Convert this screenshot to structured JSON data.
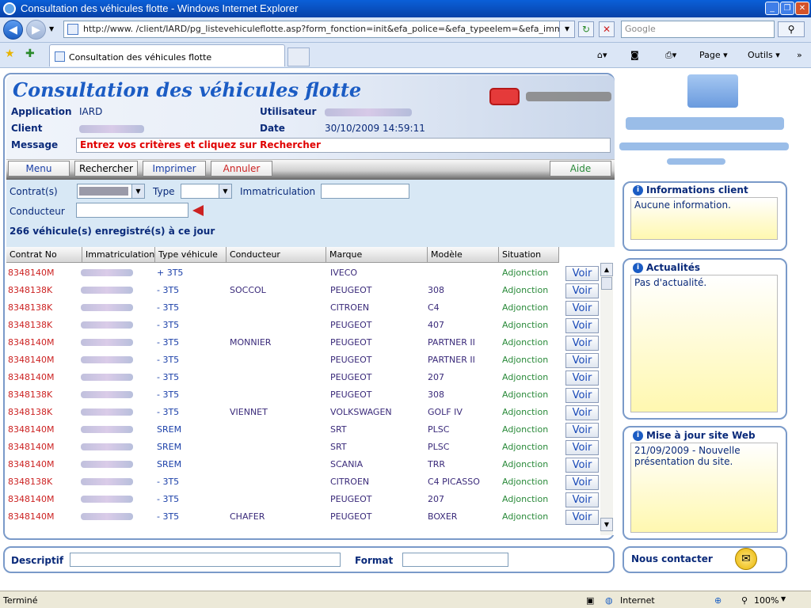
{
  "window": {
    "title": "Consultation des véhicules flotte - Windows Internet Explorer"
  },
  "browser": {
    "url": "http://www.                   /client/IARD/pg_listevehiculeflotte.asp?form_fonction=init&efa_police=&efa_typeelem=&efa_imma",
    "search_placeholder": "Google",
    "tab_label": "Consultation des véhicules flotte",
    "cmd_page": "Page",
    "cmd_outils": "Outils"
  },
  "header": {
    "title": "Consultation des véhicules flotte",
    "application_label": "Application",
    "application_value": "IARD",
    "utilisateur_label": "Utilisateur",
    "client_label": "Client",
    "date_label": "Date",
    "date_value": "30/10/2009 14:59:11",
    "message_label": "Message",
    "message_value": "Entrez vos critères et cliquez sur Rechercher"
  },
  "toolbar": {
    "menu": "Menu",
    "rechercher": "Rechercher",
    "imprimer": "Imprimer",
    "annuler": "Annuler",
    "aide": "Aide"
  },
  "filters": {
    "contrat_label": "Contrat(s)",
    "type_label": "Type",
    "immat_label": "Immatriculation",
    "conducteur_label": "Conducteur",
    "count_text": "266 véhicule(s) enregistré(s) à ce jour"
  },
  "grid": {
    "headers": [
      "Contrat No",
      "Immatriculation",
      "Type véhicule",
      "Conducteur",
      "Marque",
      "Modèle",
      "Situation"
    ],
    "voir_label": "Voir",
    "rows": [
      {
        "contrat": "8348140M",
        "type": "+ 3T5",
        "conducteur": "",
        "marque": "IVECO",
        "modele": "",
        "situation": "Adjonction"
      },
      {
        "contrat": "8348138K",
        "type": "- 3T5",
        "conducteur": "SOCCOL",
        "marque": "PEUGEOT",
        "modele": "308",
        "situation": "Adjonction"
      },
      {
        "contrat": "8348138K",
        "type": "- 3T5",
        "conducteur": "",
        "marque": "CITROEN",
        "modele": "C4",
        "situation": "Adjonction"
      },
      {
        "contrat": "8348138K",
        "type": "- 3T5",
        "conducteur": "",
        "marque": "PEUGEOT",
        "modele": "407",
        "situation": "Adjonction"
      },
      {
        "contrat": "8348140M",
        "type": "- 3T5",
        "conducteur": "MONNIER",
        "marque": "PEUGEOT",
        "modele": "PARTNER II",
        "situation": "Adjonction"
      },
      {
        "contrat": "8348140M",
        "type": "- 3T5",
        "conducteur": "",
        "marque": "PEUGEOT",
        "modele": "PARTNER II",
        "situation": "Adjonction"
      },
      {
        "contrat": "8348140M",
        "type": "- 3T5",
        "conducteur": "",
        "marque": "PEUGEOT",
        "modele": "207",
        "situation": "Adjonction"
      },
      {
        "contrat": "8348138K",
        "type": "- 3T5",
        "conducteur": "",
        "marque": "PEUGEOT",
        "modele": "308",
        "situation": "Adjonction"
      },
      {
        "contrat": "8348138K",
        "type": "- 3T5",
        "conducteur": "VIENNET",
        "marque": "VOLKSWAGEN",
        "modele": "GOLF IV",
        "situation": "Adjonction"
      },
      {
        "contrat": "8348140M",
        "type": "SREM",
        "conducteur": "",
        "marque": "SRT",
        "modele": "PLSC",
        "situation": "Adjonction"
      },
      {
        "contrat": "8348140M",
        "type": "SREM",
        "conducteur": "",
        "marque": "SRT",
        "modele": "PLSC",
        "situation": "Adjonction"
      },
      {
        "contrat": "8348140M",
        "type": "SREM",
        "conducteur": "",
        "marque": "SCANIA",
        "modele": "TRR",
        "situation": "Adjonction"
      },
      {
        "contrat": "8348138K",
        "type": "- 3T5",
        "conducteur": "",
        "marque": "CITROEN",
        "modele": "C4 PICASSO",
        "situation": "Adjonction"
      },
      {
        "contrat": "8348140M",
        "type": "- 3T5",
        "conducteur": "",
        "marque": "PEUGEOT",
        "modele": "207",
        "situation": "Adjonction"
      },
      {
        "contrat": "8348140M",
        "type": "- 3T5",
        "conducteur": "CHAFER",
        "marque": "PEUGEOT",
        "modele": "BOXER",
        "situation": "Adjonction"
      }
    ]
  },
  "sidebar": {
    "info_title": "Informations client",
    "info_text": "Aucune information.",
    "actu_title": "Actualités",
    "actu_text": "Pas d'actualité.",
    "maj_title": "Mise à jour site Web",
    "maj_text": "21/09/2009 - Nouvelle présentation du site.",
    "contact_label": "Nous contacter"
  },
  "footer": {
    "descriptif_label": "Descriptif",
    "format_label": "Format"
  },
  "status": {
    "left": "Terminé",
    "zone": "Internet",
    "zoom": "100%"
  }
}
